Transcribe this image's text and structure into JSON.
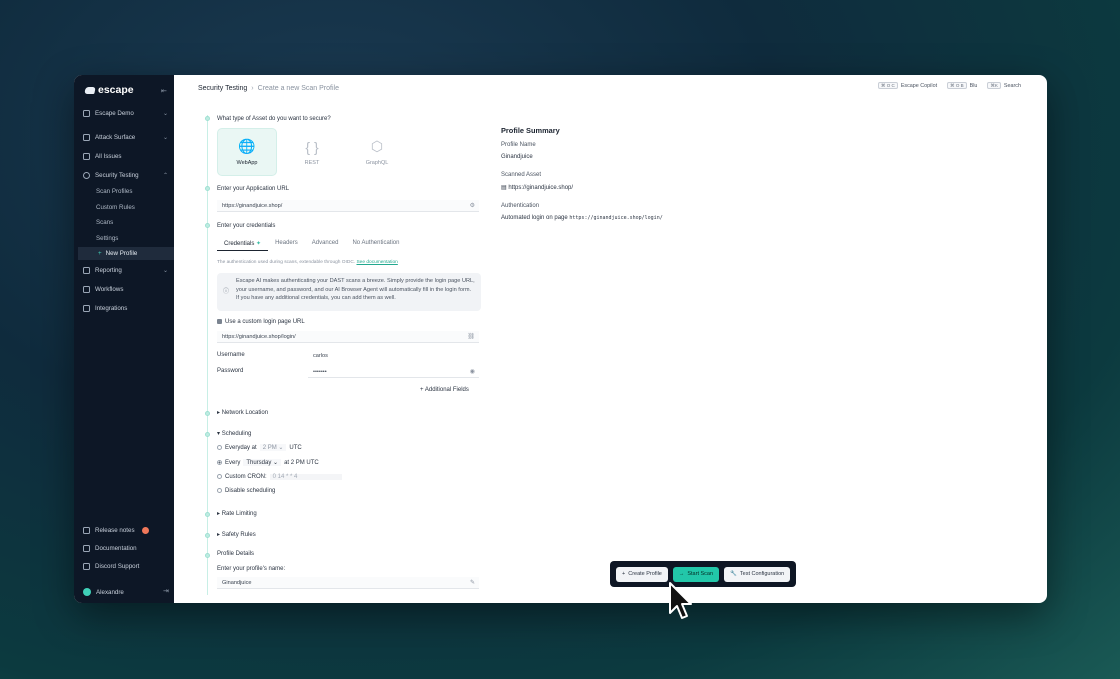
{
  "app": {
    "brand": "escape"
  },
  "sidebar": {
    "org": "Escape Demo",
    "items": [
      {
        "label": "Attack Surface",
        "icon": "surface-icon"
      },
      {
        "label": "All Issues",
        "icon": "issues-icon"
      },
      {
        "label": "Security Testing",
        "icon": "search-icon"
      }
    ],
    "security_sub": [
      "Scan Profiles",
      "Custom Rules",
      "Scans",
      "Settings"
    ],
    "new_profile": "New Profile",
    "items2": [
      {
        "label": "Reporting",
        "icon": "chart-icon"
      },
      {
        "label": "Workflows",
        "icon": "workflow-icon"
      },
      {
        "label": "Integrations",
        "icon": "plug-icon"
      }
    ],
    "bottom": [
      {
        "label": "Release notes",
        "icon": "notes-icon"
      },
      {
        "label": "Documentation",
        "icon": "doc-icon"
      },
      {
        "label": "Discord Support",
        "icon": "discord-icon"
      }
    ],
    "user": "Alexandre"
  },
  "header": {
    "crumb_root": "Security Testing",
    "crumb_current": "Create a new Scan Profile",
    "copilot_kbd": "⌘ O C",
    "copilot": "Escape Copilot",
    "blu_kbd": "⌘ O B",
    "blu": "Blu",
    "search_kbd": "⌘K",
    "search": "Search"
  },
  "form": {
    "asset_question": "What type of Asset do you want to secure?",
    "assets": [
      {
        "label": "WebApp",
        "icon": "globe-icon",
        "selected": true
      },
      {
        "label": "REST",
        "icon": "braces-icon",
        "selected": false
      },
      {
        "label": "GraphQL",
        "icon": "graphql-icon",
        "selected": false
      }
    ],
    "url_label": "Enter your Application URL",
    "url_value": "https://ginandjuice.shop/",
    "credentials_label": "Enter your credentials",
    "tabs": [
      "Credentials",
      "Headers",
      "Advanced",
      "No Authentication"
    ],
    "auth_hint": "The authentication used during scans, extendable through OIDC.",
    "auth_hint_link": "See documentation",
    "info": "Escape AI makes authenticating your DAST scans a breeze. Simply provide the login page URL, your username, and password, and our AI Browser Agent will automatically fill in the login form. If you have any additional credentials, you can add them as well.",
    "custom_login_label": "Use a custom login page URL",
    "login_url": "https://ginandjuice.shop/login/",
    "username_label": "Username",
    "username_value": "carlos",
    "password_label": "Password",
    "password_value": "•••••••",
    "additional_fields": "Additional Fields",
    "network_location": "Network Location",
    "scheduling": "Scheduling",
    "sched_everyday": "Everyday at",
    "sched_everyday_time": "2 PM",
    "sched_utc": "UTC",
    "sched_every": "Every",
    "sched_weekday": "Thursday",
    "sched_every_suffix": "at 2 PM UTC",
    "sched_cron": "Custom CRON:",
    "sched_cron_placeholder": "0 14 * * 4",
    "sched_disable": "Disable scheduling",
    "rate_limiting": "Rate Limiting",
    "safety_rules": "Safety Rules",
    "profile_details": "Profile Details",
    "profile_name_label": "Enter your profile's name:",
    "profile_name_value": "Ginandjuice"
  },
  "summary": {
    "title": "Profile Summary",
    "name_label": "Profile Name",
    "name_value": "Ginandjuice",
    "asset_label": "Scanned Asset",
    "asset_value": "https://ginandjuice.shop/",
    "auth_label": "Authentication",
    "auth_prefix": "Automated login on page",
    "auth_url": "https://ginandjuice.shop/login/"
  },
  "actions": {
    "create": "Create Profile",
    "start": "Start Scan",
    "test": "Test Configuration"
  },
  "colors": {
    "accent": "#22c7a9",
    "sidebar_bg": "#0d1726",
    "help": "#5b4ff0"
  }
}
